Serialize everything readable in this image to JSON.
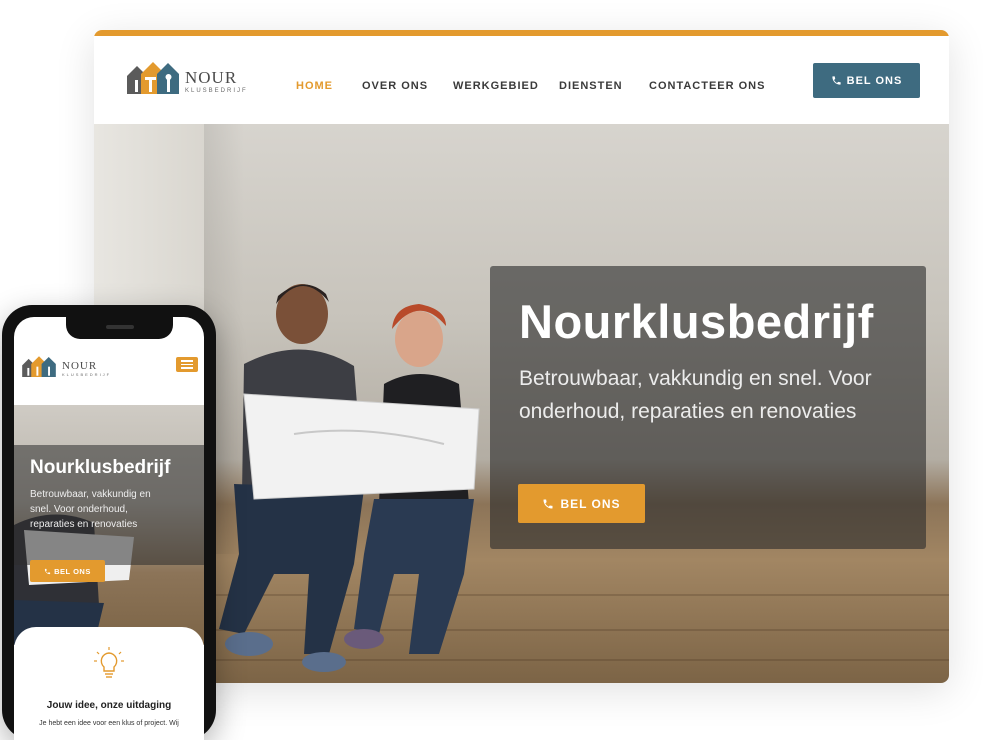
{
  "colors": {
    "accent": "#E39A2E",
    "primary": "#3E6B80",
    "dark_overlay": "#2D2D2D"
  },
  "logo": {
    "word": "NOUR",
    "sub": "KLUSBEDRIJF"
  },
  "nav": {
    "items": [
      {
        "label": "HOME",
        "active": true
      },
      {
        "label": "OVER ONS",
        "active": false
      },
      {
        "label": "WERKGEBIED",
        "active": false
      },
      {
        "label": "DIENSTEN",
        "active": false
      },
      {
        "label": "CONTACTEER ONS",
        "active": false
      }
    ]
  },
  "header": {
    "cta_label": "BEL ONS",
    "cta_icon": "phone-icon"
  },
  "hero": {
    "title": "Nourklusbedrijf",
    "subtitle": "Betrouwbaar, vakkundig en snel. Voor onderhoud, reparaties en renovaties",
    "cta_label": "BEL ONS"
  },
  "mobile": {
    "logo_word": "NOUR",
    "logo_sub": "KLUSBEDRIJF",
    "menu_icon": "hamburger-icon",
    "hero_title": "Nourklusbedrijf",
    "hero_subtitle": "Betrouwbaar, vakkundig en snel. Voor onderhoud, reparaties en renovaties",
    "cta_label": "BEL ONS",
    "card_icon": "lightbulb-icon",
    "card_title": "Jouw idee, onze uitdaging",
    "card_text": "Je hebt een idee voor een klus of project. Wij"
  }
}
